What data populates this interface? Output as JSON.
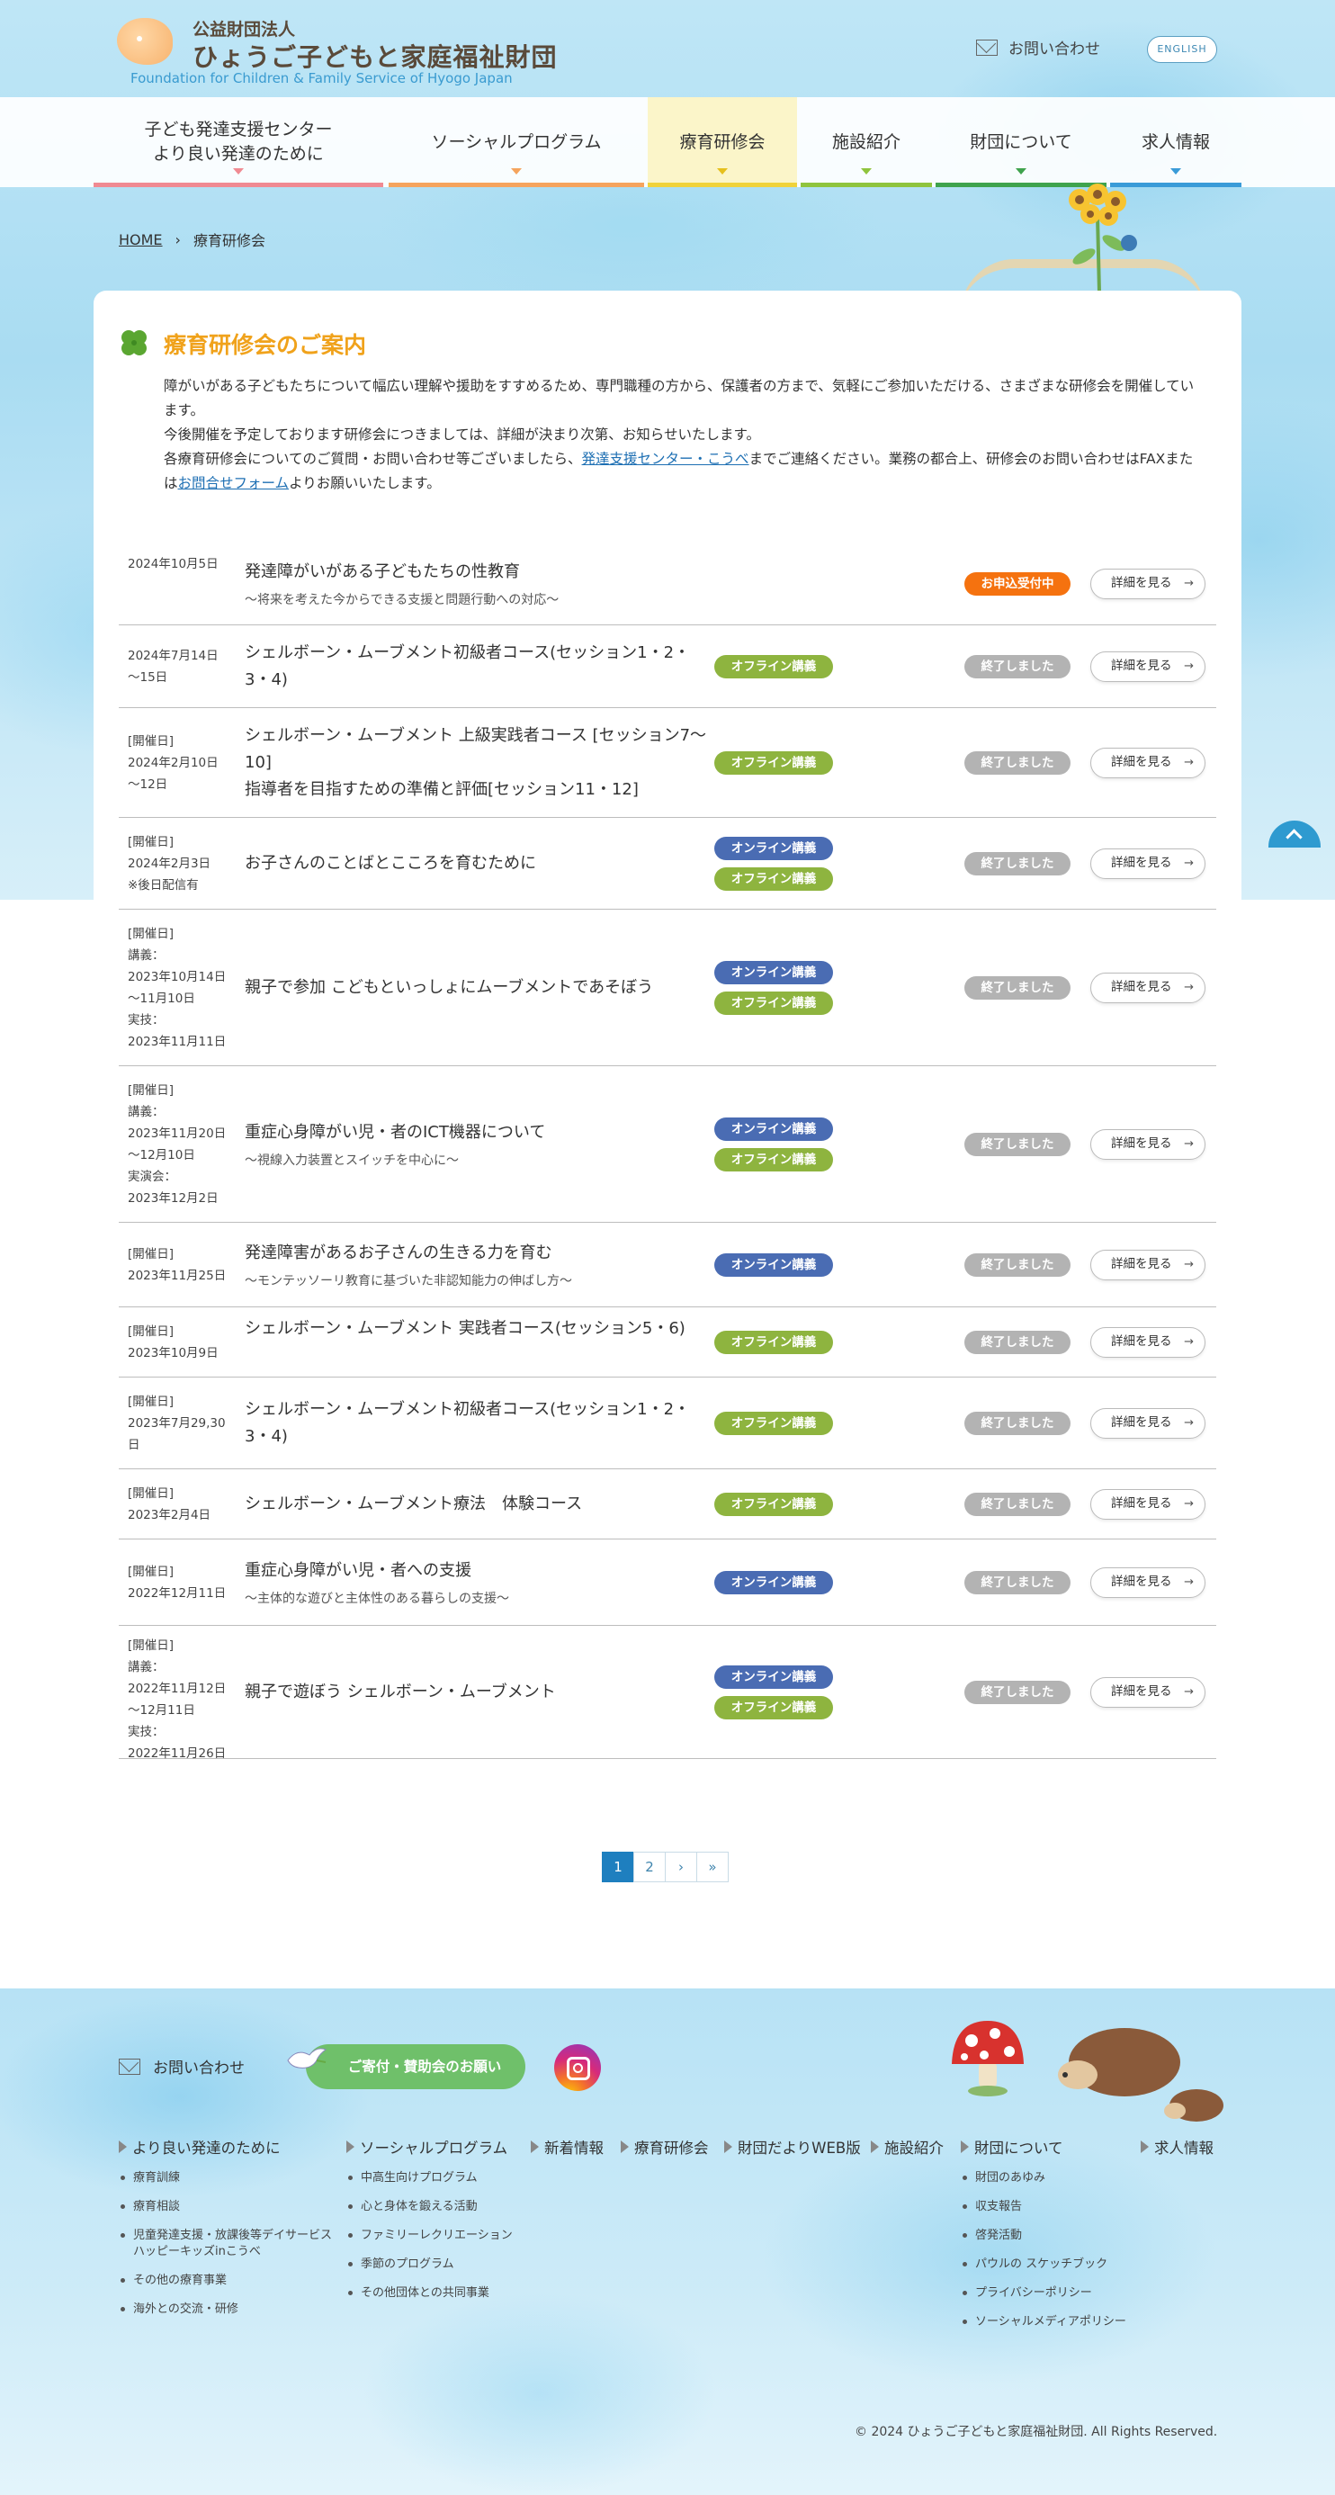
{
  "header": {
    "org_small": "公益財団法人",
    "org_name": "ひょうご子どもと家庭福祉財団",
    "org_en": "Foundation for Children & Family Service of Hyogo Japan",
    "contact_label": "お問い合わせ",
    "english_label": "ENGLISH"
  },
  "nav": {
    "items": [
      {
        "label_line1": "子ども発達支援センター",
        "label_line2": "より良い発達のために",
        "color": "#f08a92"
      },
      {
        "label_line1": "ソーシャルプログラム",
        "label_line2": "",
        "color": "#f5a45d"
      },
      {
        "label_line1": "療育研修会",
        "label_line2": "",
        "color": "#f0d23a"
      },
      {
        "label_line1": "施設紹介",
        "label_line2": "",
        "color": "#8fc43d"
      },
      {
        "label_line1": "財団について",
        "label_line2": "",
        "color": "#3fa34d"
      },
      {
        "label_line1": "求人情報",
        "label_line2": "",
        "color": "#3a9bd8"
      }
    ]
  },
  "breadcrumb": {
    "home": "HOME",
    "sep": "›",
    "current": "療育研修会"
  },
  "page": {
    "title": "療育研修会のご案内",
    "intro1": "障がいがある子どもたちについて幅広い理解や援助をすすめるため、専門職種の方から、保護者の方まで、気軽にご参加いただける、さまざまな研修会を開催しています。",
    "intro2": "今後開催を予定しております研修会につきましては、詳細が決まり次第、お知らせいたします。",
    "intro3_a": "各療育研修会についてのご質問・お問い合わせ等ございましたら、",
    "intro3_link1": "発達支援センター・こうべ",
    "intro3_b": "までご連絡ください。業務の都合上、研修会のお問い合わせはFAXまたは",
    "intro3_link2": "お問合せフォーム",
    "intro3_c": "よりお願いいたします。"
  },
  "tag_labels": {
    "online": "オンライン講義",
    "offline": "オフライン講義"
  },
  "status_labels": {
    "open": "お申込受付中",
    "closed": "終了しました"
  },
  "detail_label": "詳細を見る",
  "seminars": [
    {
      "date": [
        "2024年10月5日"
      ],
      "title": "発達障がいがある子どもたちの性教育",
      "subtitle": "～将来を考えた今からできる支援と問題行動への対応～",
      "tags": [],
      "status": "open"
    },
    {
      "date": [
        "2024年7月14日",
        "～15日"
      ],
      "title": "シェルボーン・ムーブメント初級者コース(セッション1・2・3・4)",
      "subtitle": "",
      "tags": [
        "offline"
      ],
      "status": "closed"
    },
    {
      "date": [
        "[開催日]",
        "2024年2月10日",
        "～12日"
      ],
      "title": "シェルボーン・ムーブメント 上級実践者コース [セッション7～10]",
      "title2": "指導者を目指すための準備と評価[セッション11・12]",
      "subtitle": "",
      "tags": [
        "offline"
      ],
      "status": "closed"
    },
    {
      "date": [
        "[開催日]",
        "2024年2月3日",
        "※後日配信有"
      ],
      "title": "お子さんのことばとこころを育むために",
      "subtitle": "",
      "tags": [
        "online",
        "offline"
      ],
      "status": "closed"
    },
    {
      "date": [
        "[開催日]",
        "講義：",
        "2023年10月14日",
        "～11月10日",
        "実技：",
        "2023年11月11日"
      ],
      "title": "親子で参加 こどもといっしょにムーブメントであそぼう",
      "subtitle": "",
      "tags": [
        "online",
        "offline"
      ],
      "status": "closed"
    },
    {
      "date": [
        "[開催日]",
        "講義：",
        "2023年11月20日",
        "～12月10日",
        "実演会：",
        "2023年12月2日"
      ],
      "title": "重症心身障がい児・者のICT機器について",
      "subtitle": "～視線入力装置とスイッチを中心に～",
      "tags": [
        "online",
        "offline"
      ],
      "status": "closed"
    },
    {
      "date": [
        "[開催日]",
        "2023年11月25日"
      ],
      "title": "発達障害があるお子さんの生きる力を育む",
      "subtitle": "～モンテッソーリ教育に基づいた非認知能力の伸ばし方～",
      "tags": [
        "online"
      ],
      "status": "closed"
    },
    {
      "date": [
        "[開催日]",
        "2023年10月9日"
      ],
      "title": "シェルボーン・ムーブメント 実践者コース(セッション5・6)",
      "subtitle": "",
      "tags": [
        "offline"
      ],
      "status": "closed"
    },
    {
      "date": [
        "[開催日]",
        "2023年7月29,30",
        "日"
      ],
      "title": "シェルボーン・ムーブメント初級者コース(セッション1・2・3・4)",
      "subtitle": "",
      "tags": [
        "offline"
      ],
      "status": "closed"
    },
    {
      "date": [
        "[開催日]",
        "2023年2月4日"
      ],
      "title": "シェルボーン・ムーブメント療法　体験コース",
      "subtitle": "",
      "tags": [
        "offline"
      ],
      "status": "closed"
    },
    {
      "date": [
        "[開催日]",
        "2022年12月11日"
      ],
      "title": "重症心身障がい児・者への支援",
      "subtitle": "～主体的な遊びと主体性のある暮らしの支援～",
      "tags": [
        "online"
      ],
      "status": "closed"
    },
    {
      "date": [
        "[開催日]",
        "講義：",
        "2022年11月12日",
        "～12月11日",
        "実技：",
        "2022年11月26日"
      ],
      "title": "親子で遊ぼう シェルボーン・ムーブメント",
      "subtitle": "",
      "tags": [
        "online",
        "offline"
      ],
      "status": "closed"
    }
  ],
  "pagination": {
    "pages": [
      "1",
      "2"
    ],
    "current": "1",
    "next": "›",
    "last": "»"
  },
  "footer": {
    "contact_label": "お問い合わせ",
    "donate_label": "ご寄付・賛助会のお願い",
    "columns": [
      {
        "head": "より良い発達のために",
        "items": [
          "療育訓練",
          "療育相談",
          "児童発達支援・放課後等デイサービス ハッピーキッズinこうべ",
          "その他の療育事業",
          "海外との交流・研修"
        ]
      },
      {
        "head": "ソーシャルプログラム",
        "items": [
          "中高生向けプログラム",
          "心と身体を鍛える活動",
          "ファミリーレクリエーション",
          "季節のプログラム",
          "その他団体との共同事業"
        ]
      },
      {
        "head": "新着情報",
        "items": []
      },
      {
        "head": "療育研修会",
        "items": []
      },
      {
        "head": "財団だよりWEB版",
        "items": []
      },
      {
        "head": "施設紹介",
        "items": []
      },
      {
        "head": "財団について",
        "items": [
          "財団のあゆみ",
          "収支報告",
          "啓発活動",
          "パウルの スケッチブック",
          "プライバシーポリシー",
          "ソーシャルメディアポリシー"
        ]
      },
      {
        "head": "求人情報",
        "items": []
      }
    ],
    "copyright": "© 2024 ひょうご子どもと家庭福祉財団. All Rights Reserved."
  }
}
